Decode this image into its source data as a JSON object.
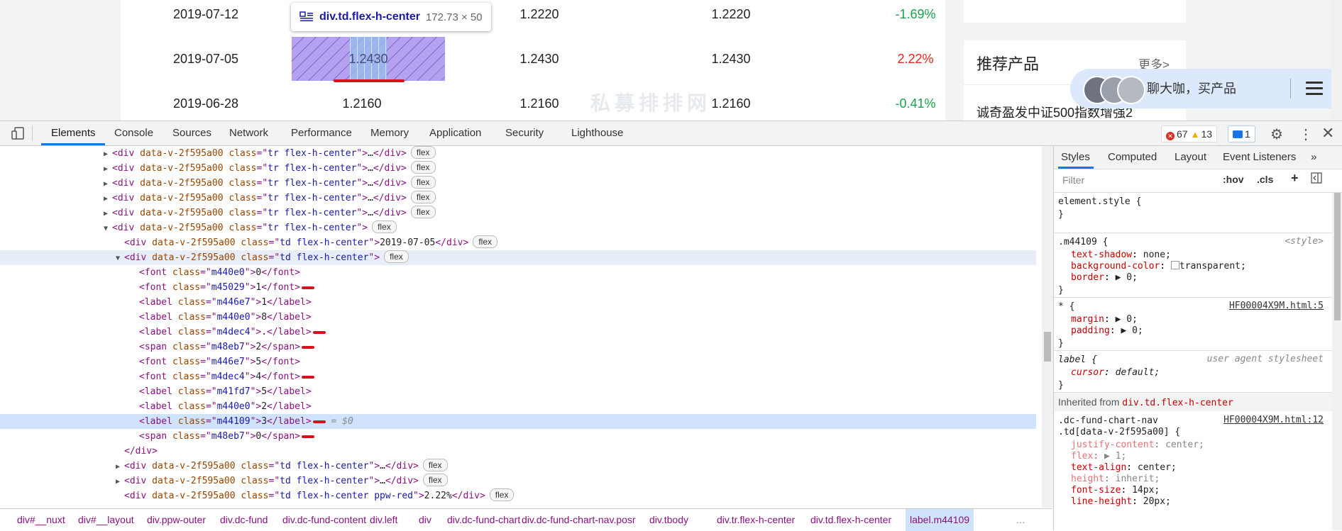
{
  "page": {
    "rows": [
      {
        "date": "2019-07-12",
        "v1": "",
        "v2": "1.2220",
        "v3": "1.2220",
        "change": "-1.69%",
        "dir": "down"
      },
      {
        "date": "2019-07-05",
        "v1": "1.2430",
        "v2": "1.2430",
        "v3": "1.2430",
        "change": "2.22%",
        "dir": "up"
      },
      {
        "date": "2019-06-28",
        "v1": "1.2160",
        "v2": "1.2160",
        "v3": "1.2160",
        "change": "-0.41%",
        "dir": "down"
      }
    ],
    "tooltip": {
      "name": "div.td.flex-h-center",
      "size": "172.73 × 50"
    },
    "watermark": "私募排排网",
    "recommend": {
      "title": "推荐产品",
      "more": "更多>",
      "item": "诚奇盈发中证500指数增强2"
    },
    "chat": {
      "text": "聊大咖，买产品"
    },
    "colors": {
      "red": "#e8231d",
      "green": "#1aa34a"
    }
  },
  "devtools": {
    "tabs": [
      "Elements",
      "Console",
      "Sources",
      "Network",
      "Performance",
      "Memory",
      "Application",
      "Security",
      "Lighthouse"
    ],
    "active_tab": "Elements",
    "errors": "67",
    "warnings": "13",
    "messages": "1",
    "tree": [
      {
        "indent": 0,
        "tri": "▶",
        "tag": "div",
        "attrs": [
          [
            "data-v-2f595a00",
            ""
          ],
          [
            "class",
            "tr flex-h-center"
          ]
        ],
        "inner": "…",
        "close": "div",
        "badge": "flex"
      },
      {
        "indent": 0,
        "tri": "▶",
        "tag": "div",
        "attrs": [
          [
            "data-v-2f595a00",
            ""
          ],
          [
            "class",
            "tr flex-h-center"
          ]
        ],
        "inner": "…",
        "close": "div",
        "badge": "flex"
      },
      {
        "indent": 0,
        "tri": "▶",
        "tag": "div",
        "attrs": [
          [
            "data-v-2f595a00",
            ""
          ],
          [
            "class",
            "tr flex-h-center"
          ]
        ],
        "inner": "…",
        "close": "div",
        "badge": "flex"
      },
      {
        "indent": 0,
        "tri": "▶",
        "tag": "div",
        "attrs": [
          [
            "data-v-2f595a00",
            ""
          ],
          [
            "class",
            "tr flex-h-center"
          ]
        ],
        "inner": "…",
        "close": "div",
        "badge": "flex"
      },
      {
        "indent": 0,
        "tri": "▶",
        "tag": "div",
        "attrs": [
          [
            "data-v-2f595a00",
            ""
          ],
          [
            "class",
            "tr flex-h-center"
          ]
        ],
        "inner": "…",
        "close": "div",
        "badge": "flex"
      },
      {
        "indent": 0,
        "tri": "▼",
        "tag": "div",
        "attrs": [
          [
            "data-v-2f595a00",
            ""
          ],
          [
            "class",
            "tr flex-h-center"
          ]
        ],
        "inner": "",
        "close": "",
        "badge": "flex"
      },
      {
        "indent": 1,
        "tri": "",
        "tag": "div",
        "attrs": [
          [
            "data-v-2f595a00",
            ""
          ],
          [
            "class",
            "td flex-h-center"
          ]
        ],
        "inner": "2019-07-05",
        "close": "div",
        "badge": "flex"
      },
      {
        "indent": 1,
        "tri": "▼",
        "tag": "div",
        "attrs": [
          [
            "data-v-2f595a00",
            ""
          ],
          [
            "class",
            "td flex-h-center"
          ]
        ],
        "inner": "",
        "close": "",
        "badge": "flex",
        "hover": true
      },
      {
        "indent": 2,
        "tri": "",
        "tag": "font",
        "attrs": [
          [
            "class",
            "m440e0"
          ]
        ],
        "inner": "0",
        "close": "font"
      },
      {
        "indent": 2,
        "tri": "",
        "tag": "font",
        "attrs": [
          [
            "class",
            "m45029"
          ]
        ],
        "inner": "1",
        "close": "font",
        "mark": true
      },
      {
        "indent": 2,
        "tri": "",
        "tag": "label",
        "attrs": [
          [
            "class",
            "m446e7"
          ]
        ],
        "inner": "1",
        "close": "label"
      },
      {
        "indent": 2,
        "tri": "",
        "tag": "label",
        "attrs": [
          [
            "class",
            "m440e0"
          ]
        ],
        "inner": "8",
        "close": "label"
      },
      {
        "indent": 2,
        "tri": "",
        "tag": "label",
        "attrs": [
          [
            "class",
            "m4dec4"
          ]
        ],
        "inner": ".",
        "close": "label",
        "mark": true
      },
      {
        "indent": 2,
        "tri": "",
        "tag": "span",
        "attrs": [
          [
            "class",
            "m48eb7"
          ]
        ],
        "inner": "2",
        "close": "span",
        "mark": true
      },
      {
        "indent": 2,
        "tri": "",
        "tag": "font",
        "attrs": [
          [
            "class",
            "m446e7"
          ]
        ],
        "inner": "5",
        "close": "font"
      },
      {
        "indent": 2,
        "tri": "",
        "tag": "font",
        "attrs": [
          [
            "class",
            "m4dec4"
          ]
        ],
        "inner": "4",
        "close": "font",
        "mark": true
      },
      {
        "indent": 2,
        "tri": "",
        "tag": "label",
        "attrs": [
          [
            "class",
            "m41fd7"
          ]
        ],
        "inner": "5",
        "close": "label"
      },
      {
        "indent": 2,
        "tri": "",
        "tag": "label",
        "attrs": [
          [
            "class",
            "m440e0"
          ]
        ],
        "inner": "2",
        "close": "label"
      },
      {
        "indent": 2,
        "tri": "",
        "tag": "label",
        "attrs": [
          [
            "class",
            "m44109"
          ]
        ],
        "inner": "3",
        "close": "label",
        "mark": true,
        "selected": true,
        "dollar": "= $0"
      },
      {
        "indent": 2,
        "tri": "",
        "tag": "span",
        "attrs": [
          [
            "class",
            "m48eb7"
          ]
        ],
        "inner": "0",
        "close": "span",
        "mark": true
      },
      {
        "indent": 1,
        "tri": "",
        "tag": "",
        "closing": "div"
      },
      {
        "indent": 1,
        "tri": "▶",
        "tag": "div",
        "attrs": [
          [
            "data-v-2f595a00",
            ""
          ],
          [
            "class",
            "td flex-h-center"
          ]
        ],
        "inner": "…",
        "close": "div",
        "badge": "flex"
      },
      {
        "indent": 1,
        "tri": "▶",
        "tag": "div",
        "attrs": [
          [
            "data-v-2f595a00",
            ""
          ],
          [
            "class",
            "td flex-h-center"
          ]
        ],
        "inner": "…",
        "close": "div",
        "badge": "flex"
      },
      {
        "indent": 1,
        "tri": "",
        "tag": "div",
        "attrs": [
          [
            "data-v-2f595a00",
            ""
          ],
          [
            "class",
            "td flex-h-center ppw-red"
          ]
        ],
        "inner": "2.22%",
        "close": "div",
        "badge": "flex"
      }
    ],
    "breadcrumbs": [
      "div#__nuxt",
      "div#__layout",
      "div.ppw-outer",
      "div.dc-fund",
      "div.dc-fund-content",
      "div.left",
      "div",
      "div.dc-fund-chart",
      "div.dc-fund-chart-nav.posr",
      "div.tbody",
      "div.tr.flex-h-center",
      "div.td.flex-h-center",
      "label.m44109",
      "…"
    ],
    "styles": {
      "tabs": [
        "Styles",
        "Computed",
        "Layout",
        "Event Listeners",
        "»"
      ],
      "filter_placeholder": "Filter",
      "hov": ":hov",
      "cls": ".cls",
      "inherited_label": "Inherited from ",
      "inherited_el": "div.td.flex-h-center"
    }
  }
}
